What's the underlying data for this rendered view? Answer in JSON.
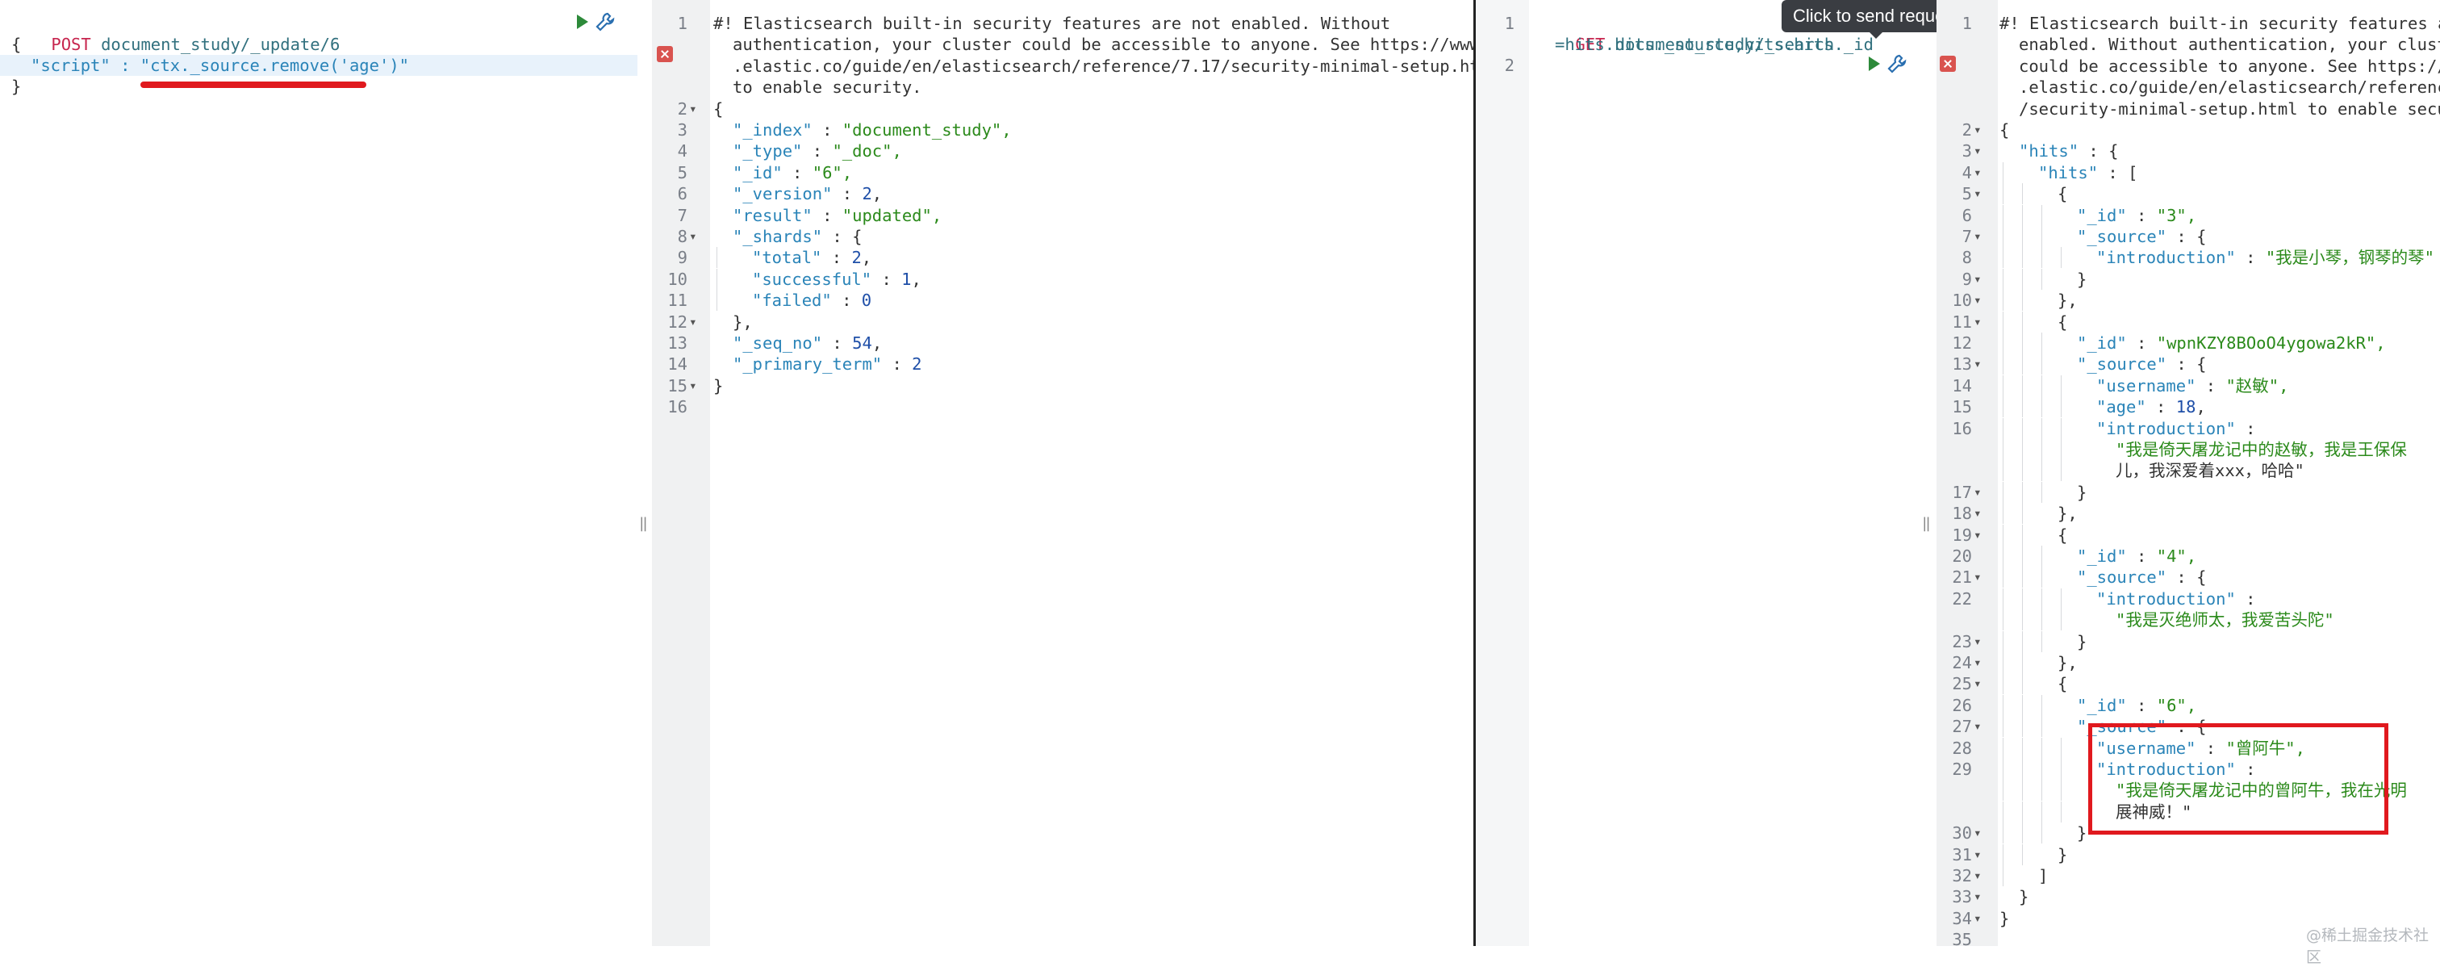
{
  "left_request": {
    "method": "POST",
    "path": "document_study/_update/6",
    "lines": [
      "{",
      "\"script\" : \"ctx._source.remove('age')\"",
      "}"
    ]
  },
  "left_response": {
    "warning_lines": [
      "#! Elasticsearch built-in security features are not enabled. Without",
      "authentication, your cluster could be accessible to anyone. See https://www",
      ".elastic.co/guide/en/elasticsearch/reference/7.17/security-minimal-setup.html",
      "to enable security."
    ],
    "body": [
      "{",
      "\"_index\" : \"document_study\",",
      "\"_type\" : \"_doc\",",
      "\"_id\" : \"6\",",
      "\"_version\" : 2,",
      "\"result\" : \"updated\",",
      "\"_shards\" : {",
      "\"total\" : 2,",
      "\"successful\" : 1,",
      "\"failed\" : 0",
      "},",
      "\"_seq_no\" : 54,",
      "\"_primary_term\" : 2",
      "}"
    ]
  },
  "right_request": {
    "method": "GET",
    "path_line1": "document_study/_search",
    "path_line2": "=hits.hits._source,hits.hits._id",
    "tooltip": "Click to send request"
  },
  "right_response": {
    "warning_lines": [
      "#! Elasticsearch built-in security features are",
      "enabled. Without authentication, your cluster",
      "could be accessible to anyone. See https://ww",
      ".elastic.co/guide/en/elasticsearch/reference/",
      "/security-minimal-setup.html to enable securi"
    ],
    "body": [
      "{",
      "\"hits\" : {",
      "\"hits\" : [",
      "{",
      "\"_id\" : \"3\",",
      "\"_source\" : {",
      "\"introduction\" : \"我是小琴，钢琴的琴\"",
      "}",
      "},",
      "{",
      "\"_id\" : \"wpnKZY8BOoO4ygowa2kR\",",
      "\"_source\" : {",
      "\"username\" : \"赵敏\",",
      "\"age\" : 18,",
      "\"introduction\" :",
      "\"我是倚天屠龙记中的赵敏，我是王保保",
      "儿，我深爱着xxx，哈哈\"",
      "}",
      "},",
      "{",
      "\"_id\" : \"4\",",
      "\"_source\" : {",
      "\"introduction\" :",
      "\"我是灭绝师太，我爱苦头陀\"",
      "}",
      "},",
      "{",
      "\"_id\" : \"6\",",
      "\"_source\" : {",
      "\"username\" : \"曾阿牛\",",
      "\"introduction\" :",
      "\"我是倚天屠龙记中的曾阿牛，我在光明",
      "展神威！\"",
      "}",
      "}",
      "]",
      "}",
      "}"
    ]
  },
  "watermark": "@稀土掘金技术社区",
  "colors": {
    "accent": "#3cb4a3",
    "annotation_red": "#e0191e"
  }
}
